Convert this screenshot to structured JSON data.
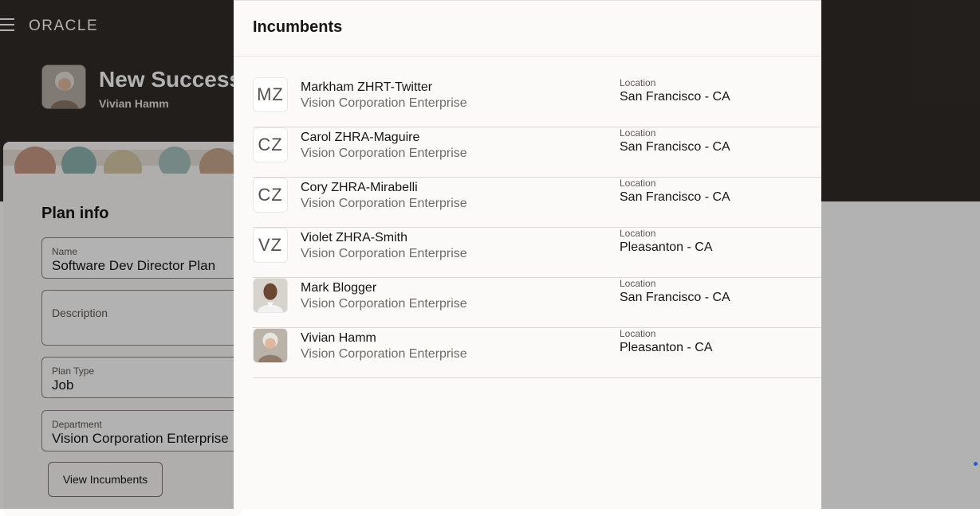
{
  "app": {
    "logo": "ORACLE"
  },
  "header": {
    "title": "New Success",
    "subtitle": "Vivian Hamm"
  },
  "plan_info": {
    "title": "Plan info",
    "fields": [
      {
        "label": "Name",
        "value": "Software Dev Director Plan"
      },
      {
        "label": "Description",
        "value": ""
      },
      {
        "label": "Plan Type",
        "value": "Job"
      },
      {
        "label": "Department",
        "value": "Vision Corporation Enterprise"
      }
    ],
    "view_button": "View Incumbents"
  },
  "drawer": {
    "title": "Incumbents",
    "incumbents": [
      {
        "initials": "MZ",
        "name": "Markham ZHRT-Twitter",
        "org": "Vision Corporation Enterprise",
        "location_label": "Location",
        "location": "San Francisco - CA",
        "avatar": "initials"
      },
      {
        "initials": "CZ",
        "name": "Carol ZHRA-Maguire",
        "org": "Vision Corporation Enterprise",
        "location_label": "Location",
        "location": "San Francisco - CA",
        "avatar": "initials"
      },
      {
        "initials": "CZ",
        "name": "Cory ZHRA-Mirabelli",
        "org": "Vision Corporation Enterprise",
        "location_label": "Location",
        "location": "San Francisco - CA",
        "avatar": "initials"
      },
      {
        "initials": "VZ",
        "name": "Violet ZHRA-Smith",
        "org": "Vision Corporation Enterprise",
        "location_label": "Location",
        "location": "Pleasanton - CA",
        "avatar": "initials"
      },
      {
        "initials": "",
        "name": "Mark Blogger",
        "org": "Vision Corporation Enterprise",
        "location_label": "Location",
        "location": "San Francisco - CA",
        "avatar": "photo-man"
      },
      {
        "initials": "",
        "name": "Vivian Hamm",
        "org": "Vision Corporation Enterprise",
        "location_label": "Location",
        "location": "Pleasanton - CA",
        "avatar": "photo-woman"
      }
    ]
  },
  "colors": {
    "header_bg": "#302c29",
    "drawer_bg": "#fbfaf8",
    "accent_dot": "#1a5fd9"
  }
}
